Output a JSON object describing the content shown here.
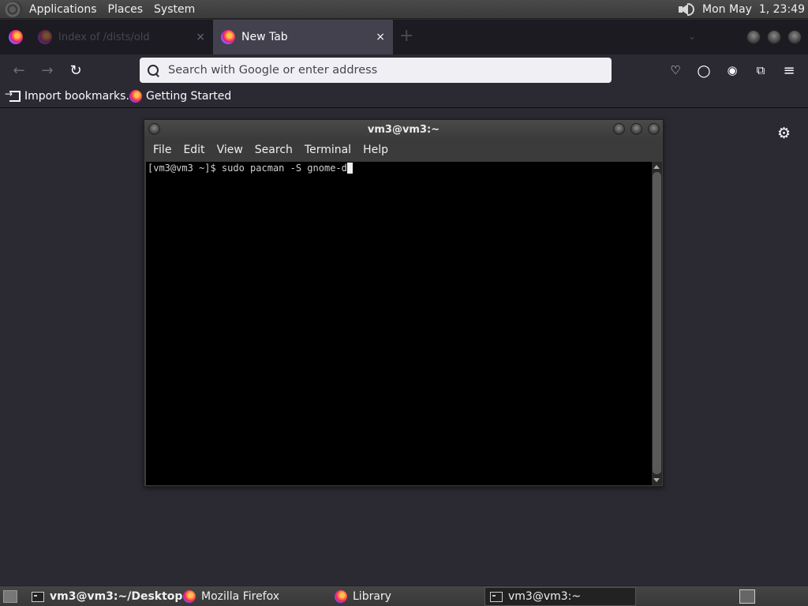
{
  "top_panel": {
    "menus": [
      "Applications",
      "Places",
      "System"
    ],
    "clock": "Mon May  1, 23:49",
    "icons": {
      "logo": "gnome-foot-icon",
      "volume": "speaker-icon"
    }
  },
  "browser": {
    "tabs": [
      {
        "label": "Index of /dists/old",
        "state": "inactive"
      },
      {
        "label": "New Tab",
        "state": "active"
      }
    ],
    "tab_close_glyph": "×",
    "new_tab_glyph": "+",
    "list_tabs_glyph": "⌄",
    "nav": {
      "back_glyph": "←",
      "forward_glyph": "→",
      "reload_glyph": "↻"
    },
    "urlbar": {
      "value": "",
      "placeholder": "Search with Google or enter address"
    },
    "toolbar_icons": [
      "pocket-icon",
      "account-circle-icon",
      "profile-icon",
      "extensions-icon",
      "menu-icon"
    ],
    "toolbar_glyphs": {
      "pocket": "♡",
      "circle": "○",
      "profile": "◉",
      "extensions": "⧉",
      "menu": "≡"
    },
    "bookmarks": [
      {
        "label": "Import bookmarks…",
        "icon": "import-icon"
      },
      {
        "label": "Getting Started",
        "icon": "firefox-icon"
      }
    ],
    "settings_glyph": "⚙"
  },
  "terminal": {
    "title": "vm3@vm3:~",
    "menu": [
      "File",
      "Edit",
      "View",
      "Search",
      "Terminal",
      "Help"
    ],
    "prompt_line": "[vm3@vm3 ~]$ sudo pacman -S gnome-d"
  },
  "taskbar": {
    "tasks": [
      {
        "label": "vm3@vm3:~/Desktop",
        "icon": "terminal-icon",
        "bold": true
      },
      {
        "label": "Mozilla Firefox",
        "icon": "firefox-icon",
        "bold": false
      },
      {
        "label": "Library",
        "icon": "firefox-icon",
        "bold": false
      },
      {
        "label": "vm3@vm3:~",
        "icon": "terminal-icon",
        "bold": false,
        "active": true
      }
    ]
  },
  "colors": {
    "browser_bg": "#2b2a33",
    "tabstrip_bg": "#1c1b22",
    "active_tab": "#42414d",
    "urlbar_bg": "#f0f0f4",
    "terminal_bg": "#000000",
    "panel_bg": "#3a3a3a"
  }
}
